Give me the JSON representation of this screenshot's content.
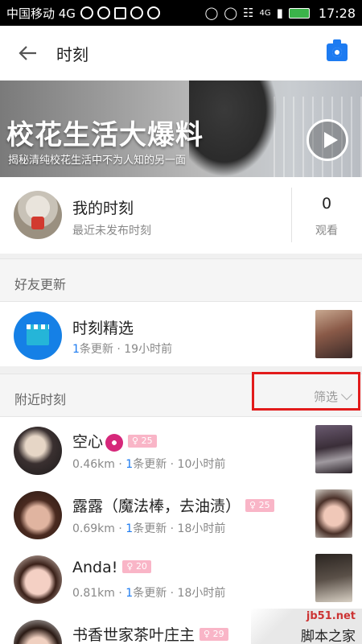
{
  "status_bar": {
    "carrier": "中国移动 4G",
    "network": "4G",
    "time": "17:28"
  },
  "header": {
    "title": "时刻",
    "back_icon": "arrow-left-icon",
    "camera_icon": "camera-icon",
    "accent": "#1d7bf1"
  },
  "banner": {
    "title": "校花生活大爆料",
    "subtitle": "揭秘清纯校花生活中不为人知的另一面",
    "play_icon": "play-icon"
  },
  "my_moments": {
    "title": "我的时刻",
    "subtitle": "最近未发布时刻",
    "count": "0",
    "count_label": "观看"
  },
  "friends_section": {
    "label": "好友更新"
  },
  "featured": {
    "title": "时刻精选",
    "count": "1",
    "sub_rest": "条更新 · 19小时前"
  },
  "nearby_section": {
    "label": "附近时刻",
    "filter_label": "筛选"
  },
  "nearby": [
    {
      "name": "空心",
      "badge": "25",
      "dist": "0.46km · ",
      "count": "1",
      "rest": "条更新 · 10小时前"
    },
    {
      "name": "露露（魔法棒，去油渍）",
      "badge": "25",
      "dist": "0.69km · ",
      "count": "1",
      "rest": "条更新 · 18小时前"
    },
    {
      "name": "Anda!",
      "badge": "20",
      "dist": "0.81km · ",
      "count": "1",
      "rest": "条更新 · 18小时前"
    },
    {
      "name": "书香世家茶叶庄主",
      "badge": "29"
    }
  ],
  "watermark": {
    "site": "jb51.net",
    "name": "脚本之家"
  }
}
